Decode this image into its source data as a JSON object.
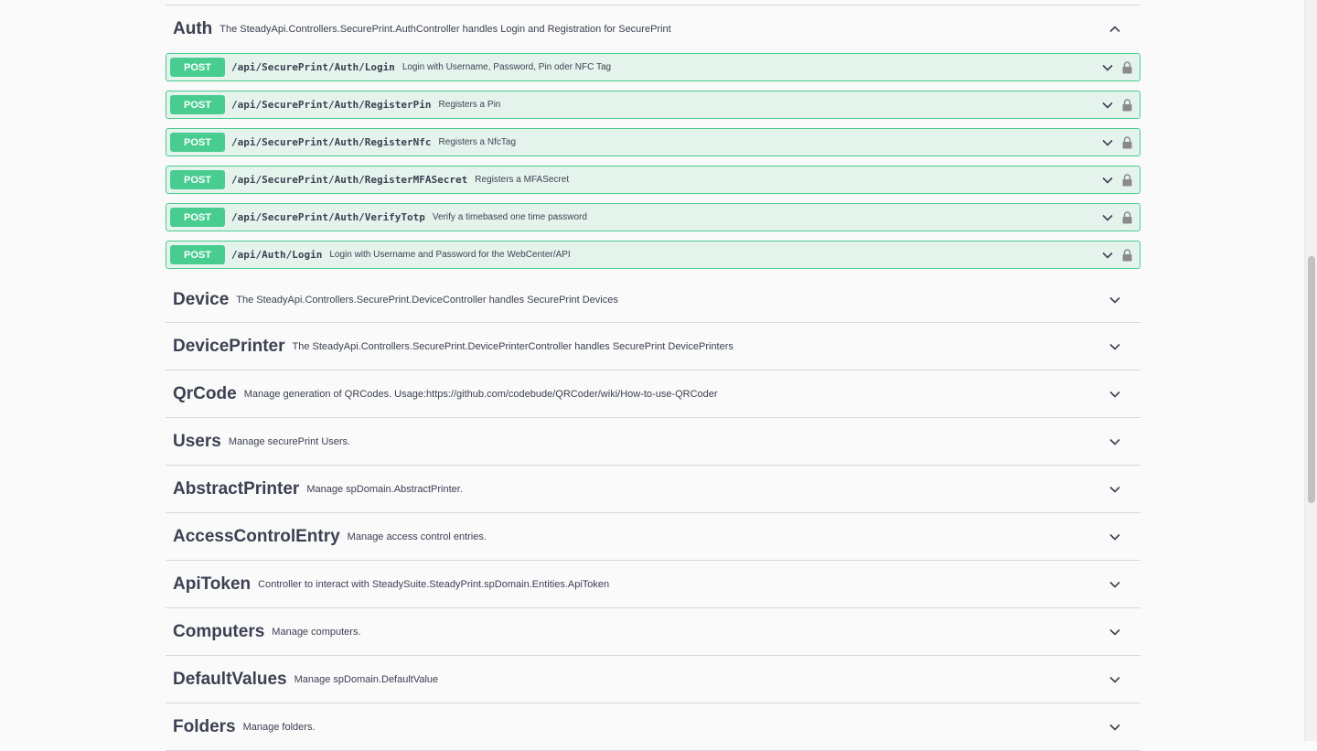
{
  "auth": {
    "name": "Auth",
    "description": "The SteadyApi.Controllers.SecurePrint.AuthController handles Login and Registration for SecurePrint",
    "operations": [
      {
        "method": "POST",
        "path": "/api/SecurePrint/Auth/Login",
        "summary": "Login with Username, Password, Pin oder NFC Tag"
      },
      {
        "method": "POST",
        "path": "/api/SecurePrint/Auth/RegisterPin",
        "summary": "Registers a Pin"
      },
      {
        "method": "POST",
        "path": "/api/SecurePrint/Auth/RegisterNfc",
        "summary": "Registers a NfcTag"
      },
      {
        "method": "POST",
        "path": "/api/SecurePrint/Auth/RegisterMFASecret",
        "summary": "Registers a MFASecret"
      },
      {
        "method": "POST",
        "path": "/api/SecurePrint/Auth/VerifyTotp",
        "summary": "Verify a timebased one time password"
      },
      {
        "method": "POST",
        "path": "/api/Auth/Login",
        "summary": "Login with Username and Password for the WebCenter/API"
      }
    ]
  },
  "tags": [
    {
      "name": "Device",
      "description": "The SteadyApi.Controllers.SecurePrint.DeviceController handles SecurePrint Devices"
    },
    {
      "name": "DevicePrinter",
      "description": "The SteadyApi.Controllers.SecurePrint.DevicePrinterController handles SecurePrint DevicePrinters"
    },
    {
      "name": "QrCode",
      "description": "Manage generation of QRCodes. Usage:https://github.com/codebude/QRCoder/wiki/How-to-use-QRCoder"
    },
    {
      "name": "Users",
      "description": "Manage securePrint Users."
    },
    {
      "name": "AbstractPrinter",
      "description": "Manage spDomain.AbstractPrinter."
    },
    {
      "name": "AccessControlEntry",
      "description": "Manage access control entries."
    },
    {
      "name": "ApiToken",
      "description": "Controller to interact with SteadySuite.SteadyPrint.spDomain.Entities.ApiToken"
    },
    {
      "name": "Computers",
      "description": "Manage computers."
    },
    {
      "name": "DefaultValues",
      "description": "Manage spDomain.DefaultValue"
    },
    {
      "name": "Folders",
      "description": "Manage folders."
    }
  ],
  "icons": {
    "expanded": "chevron-up-icon",
    "collapsed": "chevron-down-icon",
    "lock": "lock-icon"
  },
  "colors": {
    "post": "#49cc90",
    "text": "#3b4151"
  }
}
